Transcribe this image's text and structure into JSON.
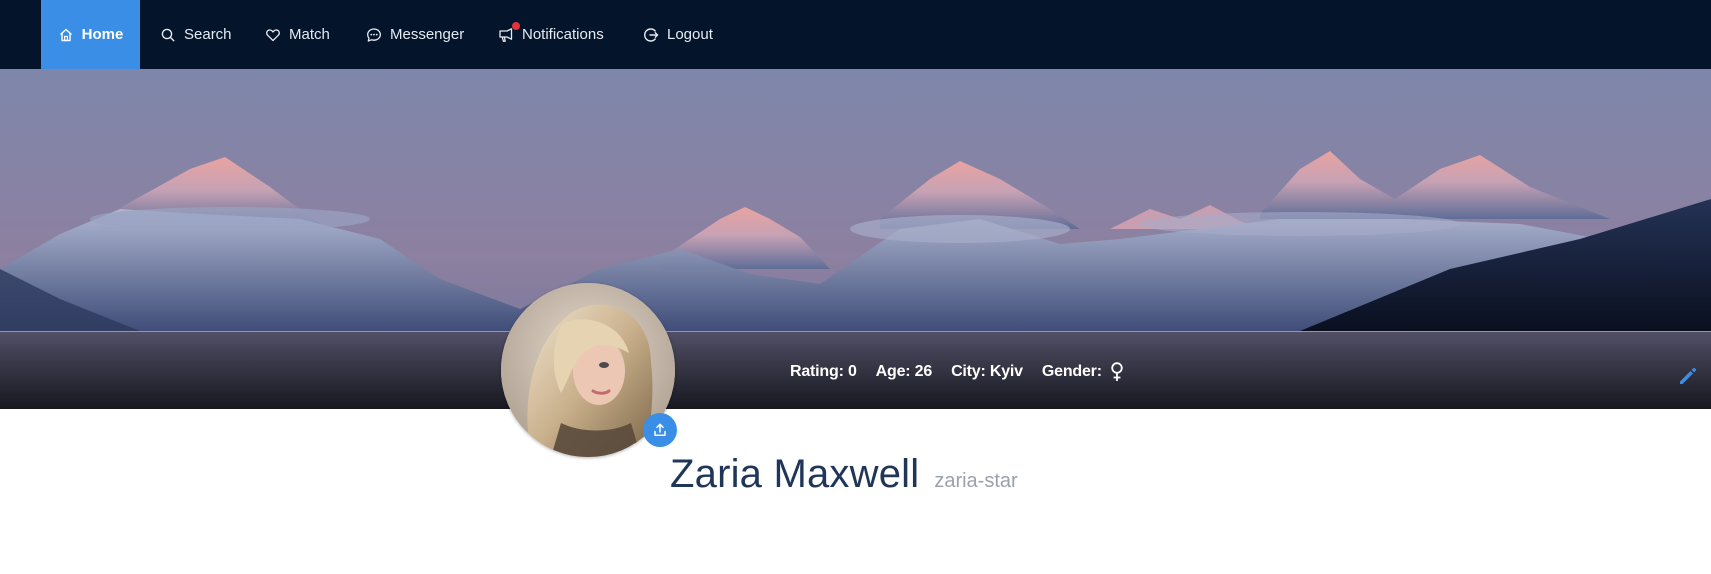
{
  "nav": {
    "items": [
      {
        "label": "Home",
        "icon": "home-icon",
        "active": true
      },
      {
        "label": "Search",
        "icon": "search-icon"
      },
      {
        "label": "Match",
        "icon": "heart-icon"
      },
      {
        "label": "Messenger",
        "icon": "chat-icon"
      },
      {
        "label": "Notifications",
        "icon": "notification-icon",
        "has_badge": true
      },
      {
        "label": "Logout",
        "icon": "logout-icon"
      }
    ]
  },
  "profile": {
    "stats": {
      "rating": "Rating: 0",
      "age": "Age: 26",
      "city": "City: Kyiv",
      "gender_label": "Gender:"
    },
    "gender_icon": "female-symbol-icon",
    "full_name": "Zaria Maxwell",
    "username": "zaria-star"
  },
  "colors": {
    "navbar_bg": "#04142a",
    "accent": "#3a8ee6",
    "badge": "#e5323b",
    "name": "#1f3658",
    "username": "#9aa1ab"
  }
}
